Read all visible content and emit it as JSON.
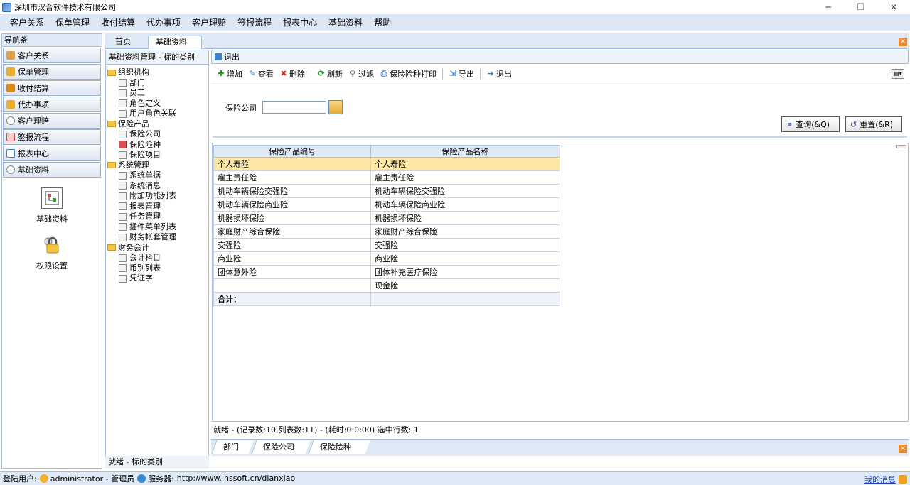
{
  "window": {
    "title": "深圳市汉合软件技术有限公司",
    "min_label": "─",
    "max_label": "❐",
    "close_label": "✕"
  },
  "menu": [
    "客户关系",
    "保单管理",
    "收付结算",
    "代办事项",
    "客户理赔",
    "签报流程",
    "报表中心",
    "基础资料",
    "帮助"
  ],
  "nav": {
    "header": "导航条",
    "items": [
      {
        "label": "客户关系",
        "icon": "customer-icon",
        "color": "#d9a44a"
      },
      {
        "label": "保单管理",
        "icon": "policy-icon",
        "color": "#e8b030"
      },
      {
        "label": "收付结算",
        "icon": "settlement-icon",
        "color": "#d98a1a"
      },
      {
        "label": "代办事项",
        "icon": "todo-icon",
        "color": "#e8b030"
      },
      {
        "label": "客户理赔",
        "icon": "claim-icon",
        "color": "#888888"
      },
      {
        "label": "签报流程",
        "icon": "flow-icon",
        "color": "#d04040"
      },
      {
        "label": "报表中心",
        "icon": "report-icon",
        "color": "#3a7fd0"
      },
      {
        "label": "基础资料",
        "icon": "basic-data-icon",
        "color": "#888888"
      }
    ],
    "big_items": [
      {
        "label": "基础资料",
        "icon": "basic-data-big-icon"
      },
      {
        "label": "权限设置",
        "icon": "permission-lock-icon"
      }
    ]
  },
  "tabs": {
    "home": "首页",
    "active": "基础资料",
    "close": "×"
  },
  "tree_panel": {
    "title": "基础资料管理 - 标的类别",
    "nodes": [
      {
        "label": "组织机构",
        "type": "folder"
      },
      {
        "label": "部门",
        "type": "leaf"
      },
      {
        "label": "员工",
        "type": "leaf"
      },
      {
        "label": "角色定义",
        "type": "leaf"
      },
      {
        "label": "用户角色关联",
        "type": "leaf"
      },
      {
        "label": "保险产品",
        "type": "folder"
      },
      {
        "label": "保险公司",
        "type": "leaf"
      },
      {
        "label": "保险险种",
        "type": "leaf-red"
      },
      {
        "label": "保险项目",
        "type": "leaf"
      },
      {
        "label": "系统管理",
        "type": "folder"
      },
      {
        "label": "系统单据",
        "type": "leaf"
      },
      {
        "label": "系统消息",
        "type": "leaf"
      },
      {
        "label": "附加功能列表",
        "type": "leaf"
      },
      {
        "label": "报表管理",
        "type": "leaf"
      },
      {
        "label": "任务管理",
        "type": "leaf"
      },
      {
        "label": "插件菜单列表",
        "type": "leaf"
      },
      {
        "label": "财务帐套管理",
        "type": "leaf"
      },
      {
        "label": "财务会计",
        "type": "folder"
      },
      {
        "label": "会计科目",
        "type": "leaf"
      },
      {
        "label": "币别列表",
        "type": "leaf"
      },
      {
        "label": "凭证字",
        "type": "leaf"
      }
    ],
    "status": "就绪 - 标的类别"
  },
  "main_top": {
    "exit_label": "退出"
  },
  "toolbar": {
    "add": "增加",
    "view": "查看",
    "delete": "删除",
    "refresh": "刷新",
    "filter": "过滤",
    "print": "保险险种打印",
    "export": "导出",
    "exit": "退出",
    "menu_icon": "▤▾"
  },
  "filter": {
    "label": "保险公司",
    "value": "",
    "query_btn": "查询(&Q)",
    "reset_btn": "重置(&R)"
  },
  "grid": {
    "columns": [
      "保险产品编号",
      "保险产品名称"
    ],
    "rows": [
      [
        "个人寿险",
        "个人寿险"
      ],
      [
        "雇主责任险",
        "雇主责任险"
      ],
      [
        "机动车辆保险交强险",
        "机动车辆保险交强险"
      ],
      [
        "机动车辆保险商业险",
        "机动车辆保险商业险"
      ],
      [
        "机器损坏保险",
        "机器损坏保险"
      ],
      [
        "家庭财产综合保险",
        "家庭财产综合保险"
      ],
      [
        "交强险",
        "交强险"
      ],
      [
        "商业险",
        "商业险"
      ],
      [
        "团体意外险",
        "团体补充医疗保险"
      ],
      [
        "",
        "现金险"
      ]
    ],
    "sum_label": "合计：",
    "status": "就绪 - (记录数:10,列表数:11) - (耗时:0:0:00) 选中行数: 1"
  },
  "bottom_tabs": [
    "部门",
    "保险公司",
    "保险险种"
  ],
  "statusbar": {
    "user_label": "登陆用户:",
    "user": "administrator - 管理员",
    "server_label": "服务器:",
    "server": "http://www.inssoft.cn/dianxiao",
    "messages": "我的消息"
  }
}
